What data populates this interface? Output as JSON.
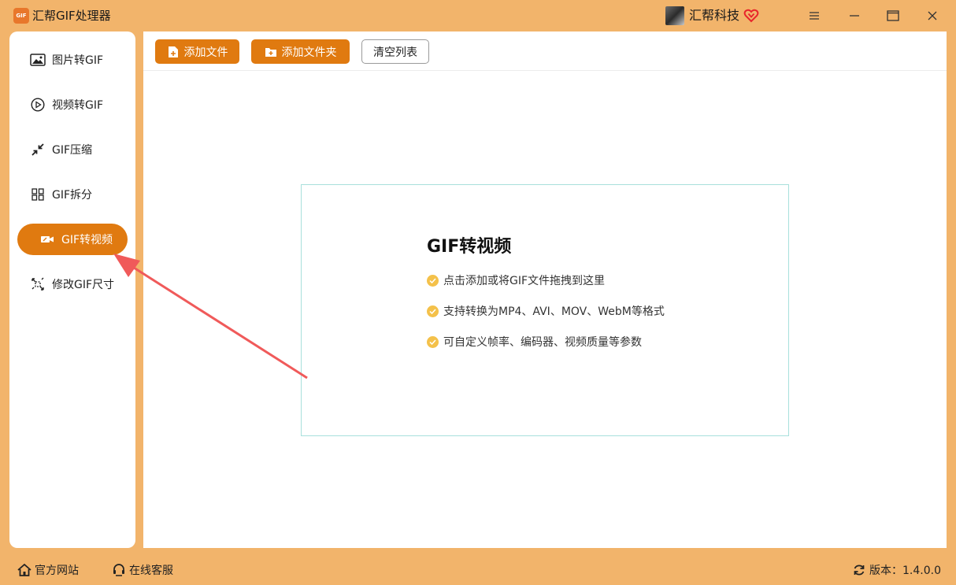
{
  "window": {
    "title": "汇帮GIF处理器",
    "logo_text": "GIF",
    "company": "汇帮科技"
  },
  "sidebar": {
    "items": [
      {
        "label": "图片转GIF",
        "icon": "image-icon"
      },
      {
        "label": "视频转GIF",
        "icon": "play-circle-icon"
      },
      {
        "label": "GIF压缩",
        "icon": "compress-icon"
      },
      {
        "label": "GIF拆分",
        "icon": "split-icon"
      },
      {
        "label": "GIF转视频",
        "icon": "video-icon",
        "active": true
      },
      {
        "label": "修改GIF尺寸",
        "icon": "resize-icon"
      }
    ]
  },
  "toolbar": {
    "add_file_label": "添加文件",
    "add_folder_label": "添加文件夹",
    "clear_list_label": "清空列表"
  },
  "dropzone": {
    "title": "GIF转视频",
    "lines": [
      "点击添加或将GIF文件拖拽到这里",
      "支持转换为MP4、AVI、MOV、WebM等格式",
      "可自定义帧率、编码器、视频质量等参数"
    ]
  },
  "footer": {
    "website_label": "官方网站",
    "support_label": "在线客服",
    "version_label": "版本：1.4.0.0"
  },
  "colors": {
    "accent": "#e07a10",
    "frame": "#f2b46b",
    "check": "#f4c14a",
    "arrow": "#f05a5a"
  }
}
